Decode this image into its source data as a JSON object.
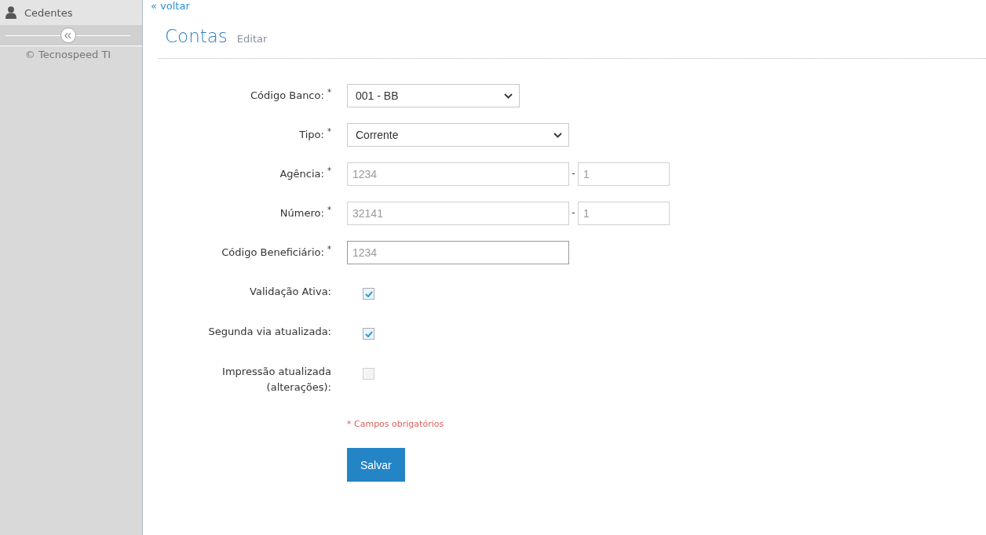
{
  "sidebar": {
    "items": [
      {
        "label": "Cedentes"
      }
    ],
    "footer": "© Tecnospeed TI"
  },
  "back_link": "« voltar",
  "header": {
    "title": "Contas",
    "subtitle": "Editar"
  },
  "form": {
    "fields": [
      {
        "kind": "select",
        "label": "Código Banco: $^{*}$",
        "value": "001 - BB"
      },
      {
        "kind": "select",
        "label": "Tipo: $^{*}$",
        "value": "Corrente"
      },
      {
        "kind": "split",
        "label": "Agência: $^{*}$",
        "placeholder": "1234",
        "separator": "-",
        "suffix_placeholder": "1",
        "focused": false
      },
      {
        "kind": "split",
        "label": "Número: $^{*}$",
        "placeholder": "32141",
        "separator": "-",
        "suffix_placeholder": "1",
        "focused": false
      },
      {
        "kind": "text",
        "label": "Código Beneficiário: $^{*}$",
        "placeholder": "1234",
        "focused": true
      },
      {
        "kind": "checkbox",
        "label": "Validação Ativa:",
        "checked": true
      },
      {
        "kind": "checkbox",
        "label": "Segunda via atualizada:",
        "checked": true
      },
      {
        "kind": "checkbox",
        "label": "Impressão atualizada (alterações):",
        "checked": false
      }
    ],
    "required_note": "* Campos obrigatórios",
    "submit_button": "Salvar"
  }
}
